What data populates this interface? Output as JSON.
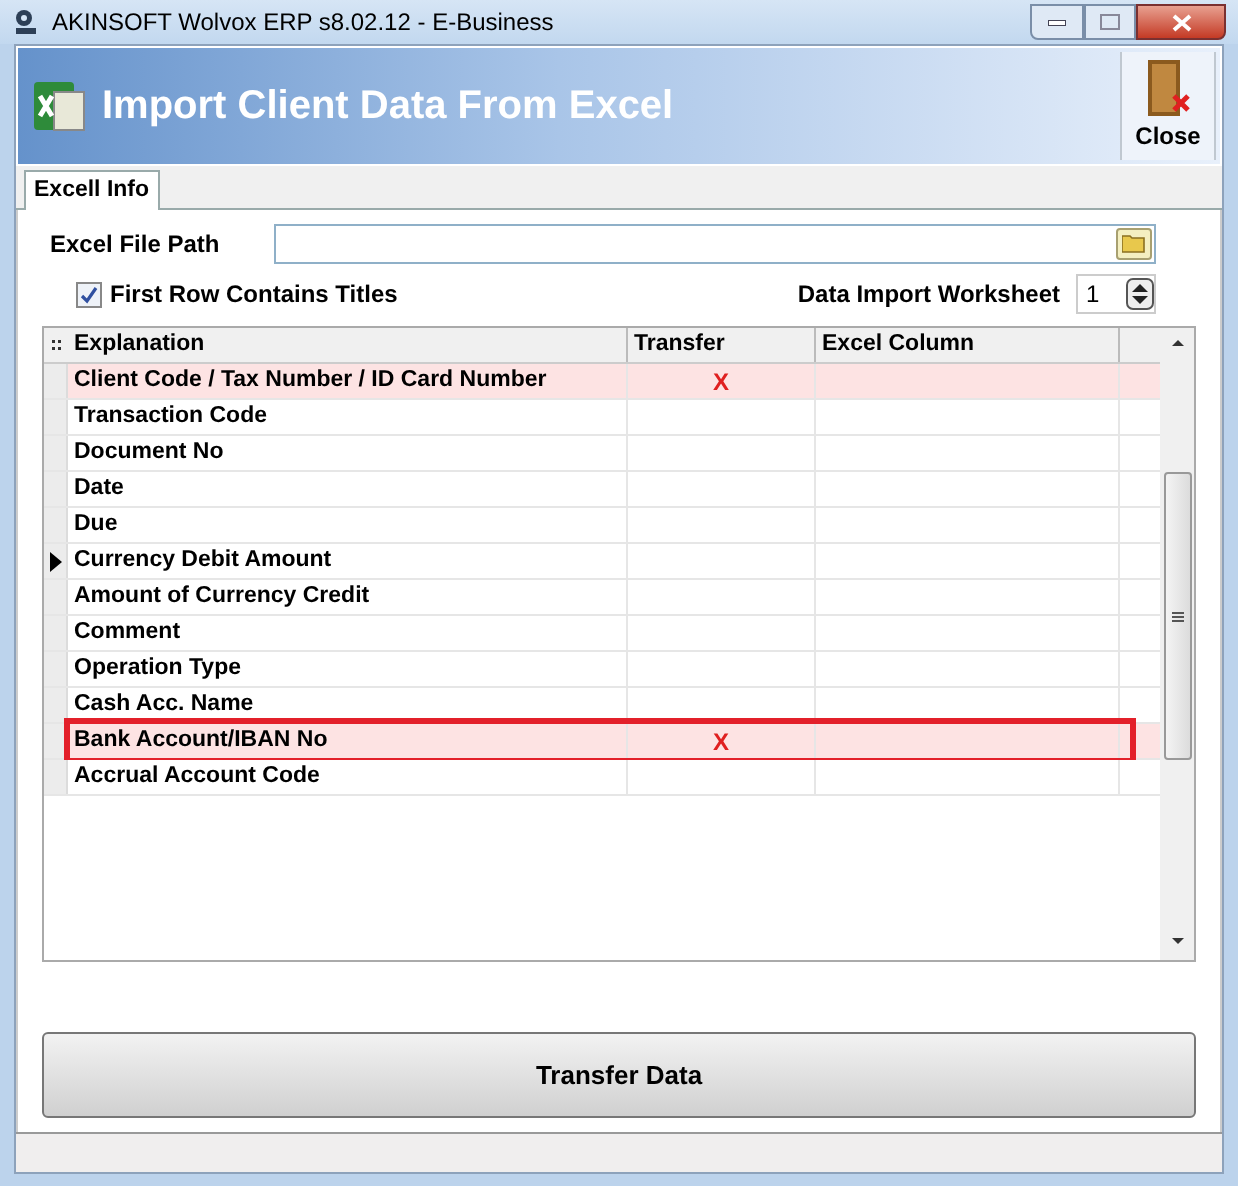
{
  "window": {
    "title": "AKINSOFT Wolvox ERP s8.02.12 - E-Business"
  },
  "header": {
    "title": "Import Client Data From Excel",
    "close_label": "Close"
  },
  "tabs": [
    {
      "label": "Excell Info",
      "selected": true
    }
  ],
  "file_path": {
    "label": "Excel File Path"
  },
  "first_row_titles": {
    "label": "First Row Contains Titles",
    "checked": true
  },
  "worksheet": {
    "label": "Data Import Worksheet",
    "value": "1"
  },
  "table": {
    "columns": [
      "Explanation",
      "Transfer",
      "Excel Column"
    ],
    "rows": [
      {
        "explanation": "Client Code / Tax Number / ID Card Number",
        "transfer": "X",
        "highlighted": true,
        "current": false,
        "annotated": false
      },
      {
        "explanation": "Transaction Code",
        "highlighted": false,
        "current": false,
        "annotated": false
      },
      {
        "explanation": "Document No",
        "highlighted": false,
        "current": false,
        "annotated": false
      },
      {
        "explanation": "Date",
        "highlighted": false,
        "current": false,
        "annotated": false
      },
      {
        "explanation": "Due",
        "highlighted": false,
        "current": false,
        "annotated": false
      },
      {
        "explanation": "Currency Debit Amount",
        "highlighted": false,
        "current": true,
        "annotated": false
      },
      {
        "explanation": "Amount of Currency Credit",
        "highlighted": false,
        "current": false,
        "annotated": false
      },
      {
        "explanation": "Comment",
        "highlighted": false,
        "current": false,
        "annotated": false
      },
      {
        "explanation": "Operation Type",
        "highlighted": false,
        "current": false,
        "annotated": false
      },
      {
        "explanation": "Cash Acc. Name",
        "highlighted": false,
        "current": false,
        "annotated": false
      },
      {
        "explanation": "Bank Account/IBAN No",
        "transfer": "X",
        "highlighted": true,
        "current": false,
        "annotated": true
      },
      {
        "explanation": "Accrual Account Code",
        "highlighted": false,
        "current": false,
        "annotated": false
      }
    ]
  },
  "transfer_button": {
    "label": "Transfer Data"
  }
}
